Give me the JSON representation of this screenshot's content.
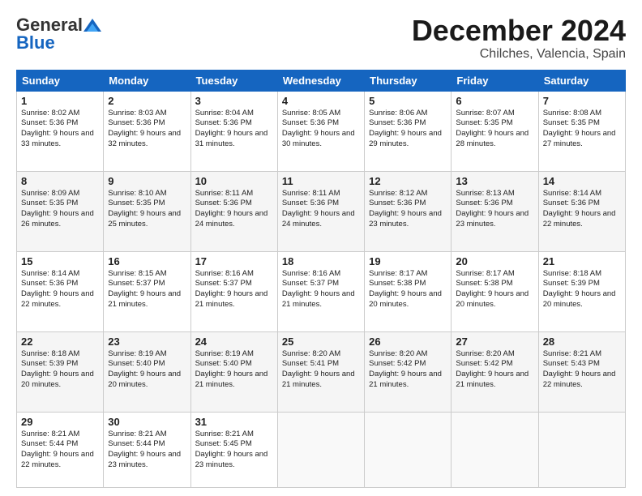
{
  "header": {
    "logo_general": "General",
    "logo_blue": "Blue",
    "month_title": "December 2024",
    "location": "Chilches, Valencia, Spain"
  },
  "days_of_week": [
    "Sunday",
    "Monday",
    "Tuesday",
    "Wednesday",
    "Thursday",
    "Friday",
    "Saturday"
  ],
  "weeks": [
    [
      {
        "day": 1,
        "sunrise": "8:02 AM",
        "sunset": "5:36 PM",
        "daylight": "9 hours and 33 minutes"
      },
      {
        "day": 2,
        "sunrise": "8:03 AM",
        "sunset": "5:36 PM",
        "daylight": "9 hours and 32 minutes"
      },
      {
        "day": 3,
        "sunrise": "8:04 AM",
        "sunset": "5:36 PM",
        "daylight": "9 hours and 31 minutes"
      },
      {
        "day": 4,
        "sunrise": "8:05 AM",
        "sunset": "5:36 PM",
        "daylight": "9 hours and 30 minutes"
      },
      {
        "day": 5,
        "sunrise": "8:06 AM",
        "sunset": "5:36 PM",
        "daylight": "9 hours and 29 minutes"
      },
      {
        "day": 6,
        "sunrise": "8:07 AM",
        "sunset": "5:35 PM",
        "daylight": "9 hours and 28 minutes"
      },
      {
        "day": 7,
        "sunrise": "8:08 AM",
        "sunset": "5:35 PM",
        "daylight": "9 hours and 27 minutes"
      }
    ],
    [
      {
        "day": 8,
        "sunrise": "8:09 AM",
        "sunset": "5:35 PM",
        "daylight": "9 hours and 26 minutes"
      },
      {
        "day": 9,
        "sunrise": "8:10 AM",
        "sunset": "5:35 PM",
        "daylight": "9 hours and 25 minutes"
      },
      {
        "day": 10,
        "sunrise": "8:11 AM",
        "sunset": "5:36 PM",
        "daylight": "9 hours and 24 minutes"
      },
      {
        "day": 11,
        "sunrise": "8:11 AM",
        "sunset": "5:36 PM",
        "daylight": "9 hours and 24 minutes"
      },
      {
        "day": 12,
        "sunrise": "8:12 AM",
        "sunset": "5:36 PM",
        "daylight": "9 hours and 23 minutes"
      },
      {
        "day": 13,
        "sunrise": "8:13 AM",
        "sunset": "5:36 PM",
        "daylight": "9 hours and 23 minutes"
      },
      {
        "day": 14,
        "sunrise": "8:14 AM",
        "sunset": "5:36 PM",
        "daylight": "9 hours and 22 minutes"
      }
    ],
    [
      {
        "day": 15,
        "sunrise": "8:14 AM",
        "sunset": "5:36 PM",
        "daylight": "9 hours and 22 minutes"
      },
      {
        "day": 16,
        "sunrise": "8:15 AM",
        "sunset": "5:37 PM",
        "daylight": "9 hours and 21 minutes"
      },
      {
        "day": 17,
        "sunrise": "8:16 AM",
        "sunset": "5:37 PM",
        "daylight": "9 hours and 21 minutes"
      },
      {
        "day": 18,
        "sunrise": "8:16 AM",
        "sunset": "5:37 PM",
        "daylight": "9 hours and 21 minutes"
      },
      {
        "day": 19,
        "sunrise": "8:17 AM",
        "sunset": "5:38 PM",
        "daylight": "9 hours and 20 minutes"
      },
      {
        "day": 20,
        "sunrise": "8:17 AM",
        "sunset": "5:38 PM",
        "daylight": "9 hours and 20 minutes"
      },
      {
        "day": 21,
        "sunrise": "8:18 AM",
        "sunset": "5:39 PM",
        "daylight": "9 hours and 20 minutes"
      }
    ],
    [
      {
        "day": 22,
        "sunrise": "8:18 AM",
        "sunset": "5:39 PM",
        "daylight": "9 hours and 20 minutes"
      },
      {
        "day": 23,
        "sunrise": "8:19 AM",
        "sunset": "5:40 PM",
        "daylight": "9 hours and 20 minutes"
      },
      {
        "day": 24,
        "sunrise": "8:19 AM",
        "sunset": "5:40 PM",
        "daylight": "9 hours and 21 minutes"
      },
      {
        "day": 25,
        "sunrise": "8:20 AM",
        "sunset": "5:41 PM",
        "daylight": "9 hours and 21 minutes"
      },
      {
        "day": 26,
        "sunrise": "8:20 AM",
        "sunset": "5:42 PM",
        "daylight": "9 hours and 21 minutes"
      },
      {
        "day": 27,
        "sunrise": "8:20 AM",
        "sunset": "5:42 PM",
        "daylight": "9 hours and 21 minutes"
      },
      {
        "day": 28,
        "sunrise": "8:21 AM",
        "sunset": "5:43 PM",
        "daylight": "9 hours and 22 minutes"
      }
    ],
    [
      {
        "day": 29,
        "sunrise": "8:21 AM",
        "sunset": "5:44 PM",
        "daylight": "9 hours and 22 minutes"
      },
      {
        "day": 30,
        "sunrise": "8:21 AM",
        "sunset": "5:44 PM",
        "daylight": "9 hours and 23 minutes"
      },
      {
        "day": 31,
        "sunrise": "8:21 AM",
        "sunset": "5:45 PM",
        "daylight": "9 hours and 23 minutes"
      },
      null,
      null,
      null,
      null
    ]
  ]
}
